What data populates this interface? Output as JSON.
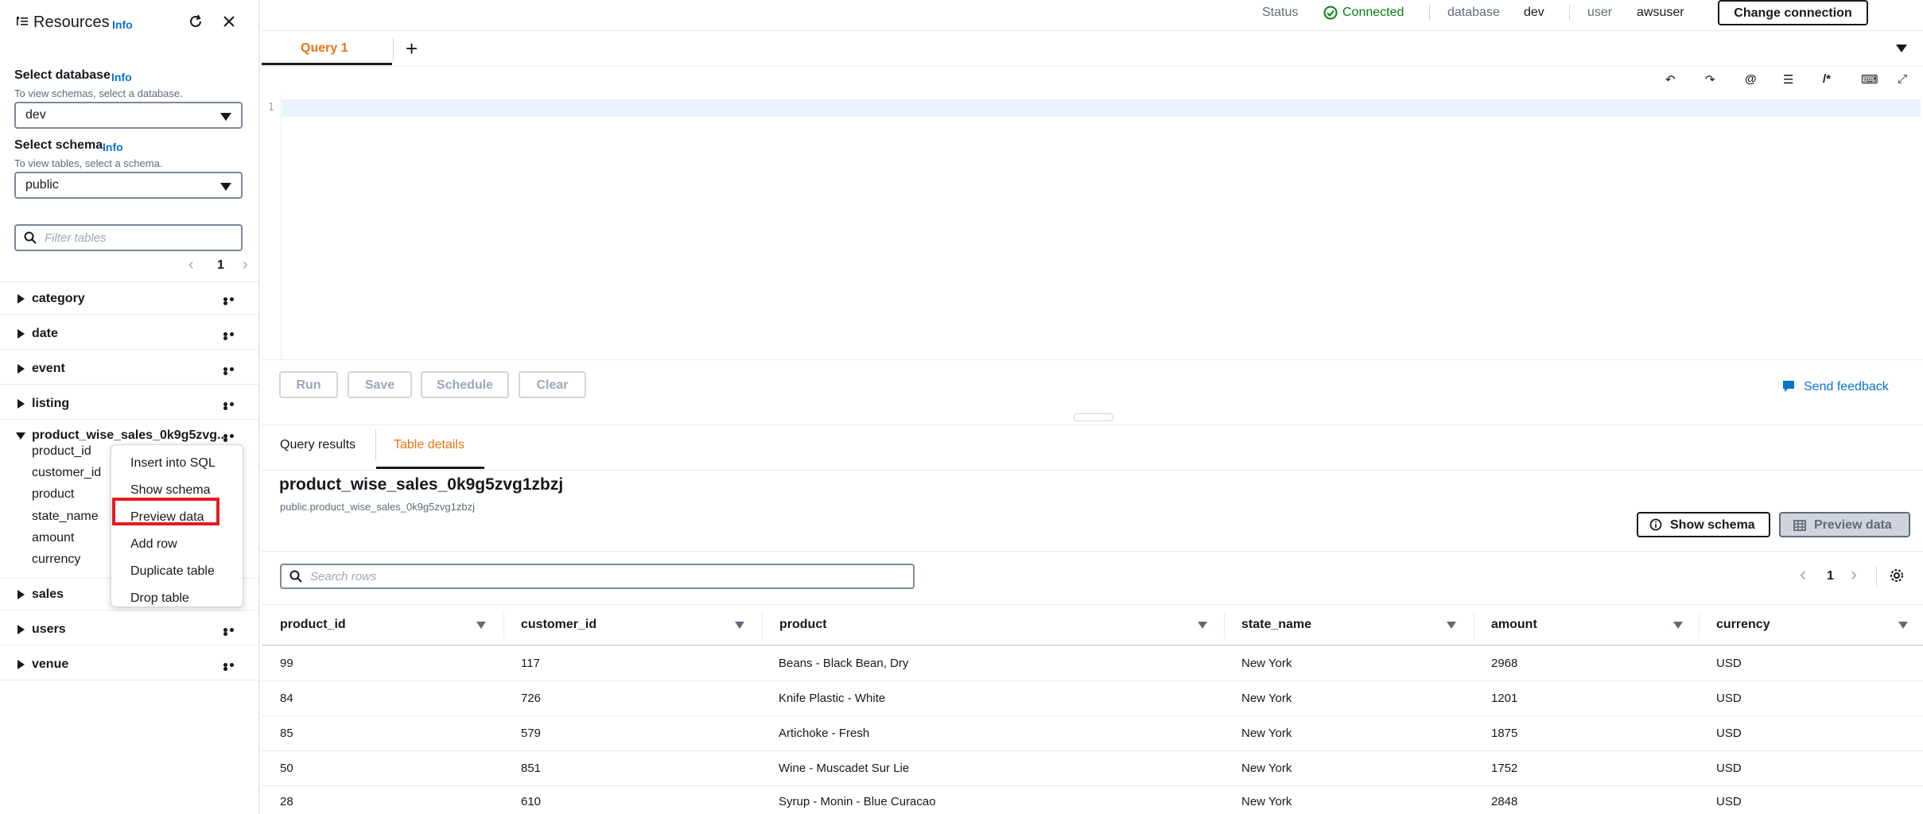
{
  "sidebar": {
    "title": "Resources",
    "info": "Info",
    "select_database": {
      "label": "Select database",
      "info": "Info",
      "description": "To view schemas, select a database.",
      "value": "dev"
    },
    "select_schema": {
      "label": "Select schema",
      "info": "Info",
      "description": "To view tables, select a schema.",
      "value": "public"
    },
    "filter": {
      "placeholder": "Filter tables"
    },
    "pagination": {
      "page": "1"
    },
    "tables": [
      {
        "name": "category"
      },
      {
        "name": "date"
      },
      {
        "name": "event"
      },
      {
        "name": "listing"
      },
      {
        "name": "product_wise_sales_0k9g5zvg..."
      },
      {
        "name": "sales"
      },
      {
        "name": "users"
      },
      {
        "name": "venue"
      }
    ],
    "expanded_columns": [
      "product_id",
      "customer_id",
      "product",
      "state_name",
      "amount",
      "currency"
    ]
  },
  "context_menu": {
    "items": [
      "Insert into SQL",
      "Show schema",
      "Preview data",
      "Add row",
      "Duplicate table",
      "Drop table"
    ],
    "highlighted": "Preview data"
  },
  "status_bar": {
    "status_label": "Status",
    "status_value": "Connected",
    "database_label": "database",
    "database_value": "dev",
    "user_label": "user",
    "user_value": "awsuser",
    "change_connection": "Change connection"
  },
  "editor": {
    "tab": "Query 1",
    "line_number": "1",
    "buttons": {
      "run": "Run",
      "save": "Save",
      "schedule": "Schedule",
      "clear": "Clear"
    },
    "feedback": "Send feedback"
  },
  "results": {
    "tabs": {
      "query_results": "Query results",
      "table_details": "Table details"
    },
    "table_name": "product_wise_sales_0k9g5zvg1zbzj",
    "table_path": "public.product_wise_sales_0k9g5zvg1zbzj",
    "show_schema": "Show schema",
    "preview_data": "Preview data",
    "search_placeholder": "Search rows",
    "page": "1",
    "columns": [
      "product_id",
      "customer_id",
      "product",
      "state_name",
      "amount",
      "currency"
    ],
    "rows": [
      [
        "99",
        "117",
        "Beans - Black Bean, Dry",
        "New York",
        "2968",
        "USD"
      ],
      [
        "84",
        "726",
        "Knife Plastic - White",
        "New York",
        "1201",
        "USD"
      ],
      [
        "85",
        "579",
        "Artichoke - Fresh",
        "New York",
        "1875",
        "USD"
      ],
      [
        "50",
        "851",
        "Wine - Muscadet Sur Lie",
        "New York",
        "1752",
        "USD"
      ],
      [
        "28",
        "610",
        "Syrup - Monin - Blue Curacao",
        "New York",
        "2848",
        "USD"
      ]
    ]
  },
  "colors": {
    "accent": "#ec7211",
    "link": "#0972d3",
    "connected": "#037f0c",
    "highlight_box": "#e7191f"
  }
}
